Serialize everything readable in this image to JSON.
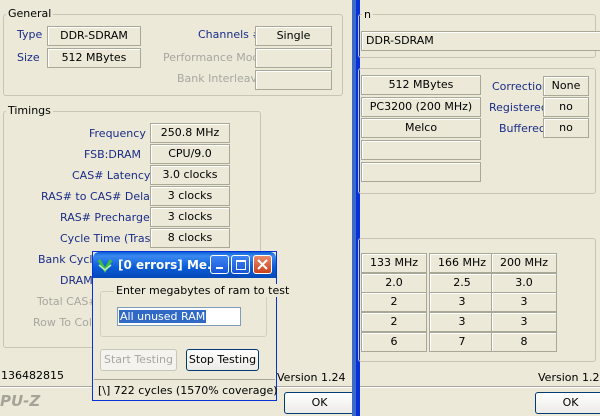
{
  "left": {
    "general": {
      "title": "General",
      "type_label": "Type",
      "type_value": "DDR-SDRAM",
      "size_label": "Size",
      "size_value": "512 MBytes",
      "channels_label": "Channels #",
      "channels_value": "Single",
      "perf_mode_label": "Performance Mode",
      "bank_interleave_label": "Bank Interleave"
    },
    "timings": {
      "title": "Timings",
      "rows": [
        {
          "label": "Frequency",
          "value": "250.8 MHz"
        },
        {
          "label": "FSB:DRAM",
          "value": "CPU/9.0"
        },
        {
          "label": "CAS# Latency",
          "value": "3.0 clocks"
        },
        {
          "label": "RAS# to CAS# Delay",
          "value": "3 clocks"
        },
        {
          "label": "RAS# Precharge",
          "value": "3 clocks"
        },
        {
          "label": "Cycle Time (Tras)",
          "value": "8 clocks"
        }
      ],
      "partial_labels": {
        "bank_cycle": "Bank Cycle",
        "dram": "DRAM",
        "total_cas": "Total CAS#",
        "row_to_col": "Row To Colu"
      }
    },
    "footer_left_text": "136482815",
    "version": "Version 1.24",
    "brand": "PU-Z",
    "ok_label": "OK"
  },
  "right": {
    "tab_partial": "n",
    "type_value": "DDR-SDRAM",
    "module_size": "512 MBytes",
    "max_bandwidth": "PC3200 (200 MHz)",
    "manufacturer": "Melco",
    "correction_label": "Correction",
    "correction_value": "None",
    "registered_label": "Registered",
    "registered_value": "no",
    "buffered_label": "Buffered",
    "buffered_value": "no",
    "spd_table": {
      "headers": [
        "133 MHz",
        "166 MHz",
        "200 MHz"
      ],
      "rows": [
        [
          "2.0",
          "2.5",
          "3.0"
        ],
        [
          "2",
          "3",
          "3"
        ],
        [
          "2",
          "3",
          "3"
        ],
        [
          "6",
          "7",
          "8"
        ]
      ]
    },
    "version": "Version 1.24",
    "ok_label": "OK"
  },
  "dialog": {
    "title": "[0 errors] Me...",
    "group_label": "Enter megabytes of ram to test",
    "input_value": "All unused RAM",
    "start_label": "Start Testing",
    "stop_label": "Stop Testing",
    "status": "[\\]  722 cycles (1570% coverage)"
  }
}
